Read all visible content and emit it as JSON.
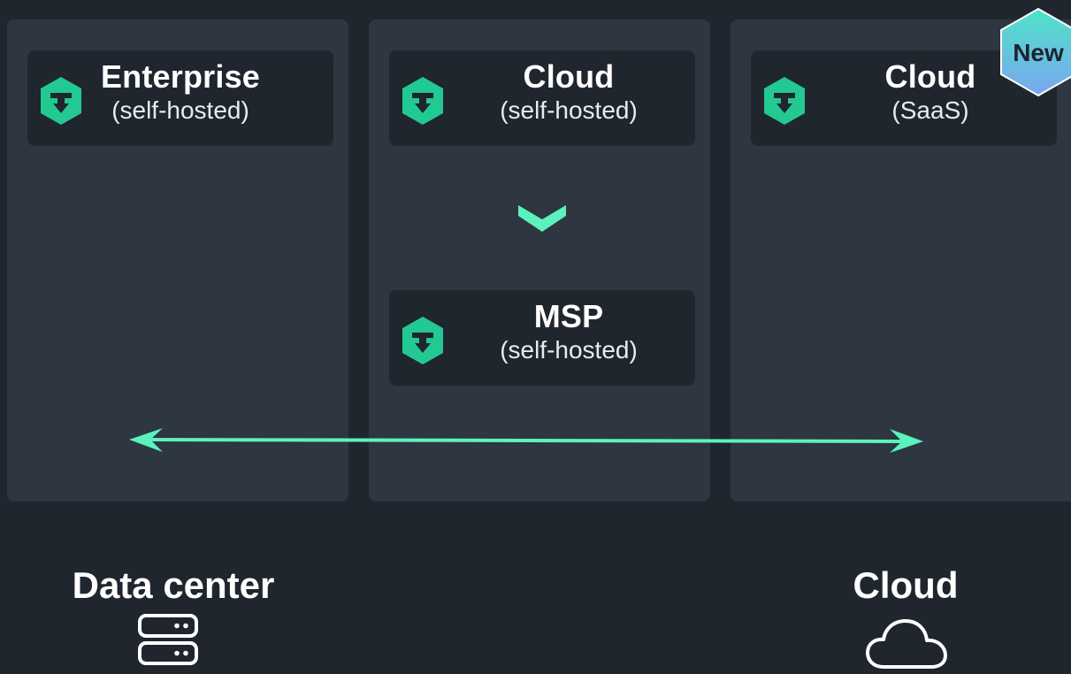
{
  "colors": {
    "page_background": "#20262e",
    "column_background": "#2d3641",
    "card_background": "#20262e",
    "accent": "#5cf2bd",
    "logo_green": "#23c993",
    "badge_gradient_start": "#4fe3c8",
    "badge_gradient_end": "#7aa6f0"
  },
  "cards": {
    "enterprise": {
      "title": "Enterprise",
      "subtitle": "(self-hosted)",
      "icon": "logo-hexagon-icon"
    },
    "cloud_self_hosted": {
      "title": "Cloud",
      "subtitle": "(self-hosted)",
      "icon": "logo-hexagon-icon"
    },
    "msp": {
      "title": "MSP",
      "subtitle": "(self-hosted)",
      "icon": "logo-hexagon-icon"
    },
    "cloud_saas": {
      "title": "Cloud",
      "subtitle": "(SaaS)",
      "icon": "logo-hexagon-icon"
    }
  },
  "badge": {
    "label": "New",
    "icon": "hexagon-badge"
  },
  "locations": {
    "data_center": {
      "label": "Data center",
      "icon": "server-icon"
    },
    "cloud": {
      "label": "Cloud",
      "icon": "cloud-icon"
    }
  },
  "connectors": {
    "chevron": "chevron-down-icon",
    "range_arrow": "double-arrow-icon"
  }
}
